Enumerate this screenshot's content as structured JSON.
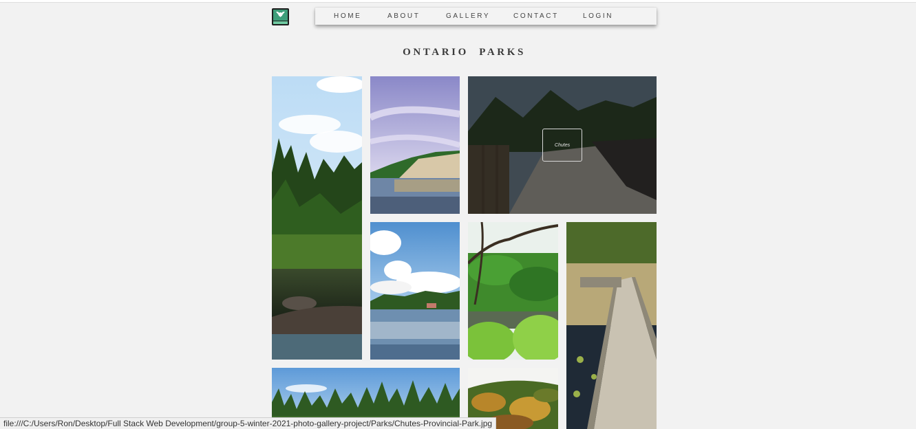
{
  "nav": {
    "logo_icon": "park-logo-icon",
    "items": [
      "HOME",
      "ABOUT",
      "GALLERY",
      "CONTACT",
      "LOGIN"
    ]
  },
  "page": {
    "title": "ONTARIO PARKS"
  },
  "gallery": {
    "photos": [
      {
        "name": "photo-forest-river",
        "subject": "forest-river-image"
      },
      {
        "name": "photo-cliff-lake",
        "subject": "cliff-lake-image"
      },
      {
        "name": "photo-chutes",
        "subject": "waterfall-image",
        "hover_caption": "Chutes"
      },
      {
        "name": "photo-lake-clouds",
        "subject": "lake-clouds-image"
      },
      {
        "name": "photo-green-valley",
        "subject": "green-valley-image"
      },
      {
        "name": "photo-boardwalk",
        "subject": "boardwalk-image"
      },
      {
        "name": "photo-pine-shore",
        "subject": "pine-shore-image"
      },
      {
        "name": "photo-autumn-hill",
        "subject": "autumn-hill-image"
      }
    ]
  },
  "status_bar": {
    "url": "file:///C:/Users/Ron/Desktop/Full Stack Web Development/group-5-winter-2021-photo-gallery-project/Parks/Chutes-Provincial-Park.jpg"
  },
  "colors": {
    "background": "#f2f2f2",
    "nav_text": "#444444",
    "title": "#3b3b3b",
    "overlay": "#141414"
  }
}
